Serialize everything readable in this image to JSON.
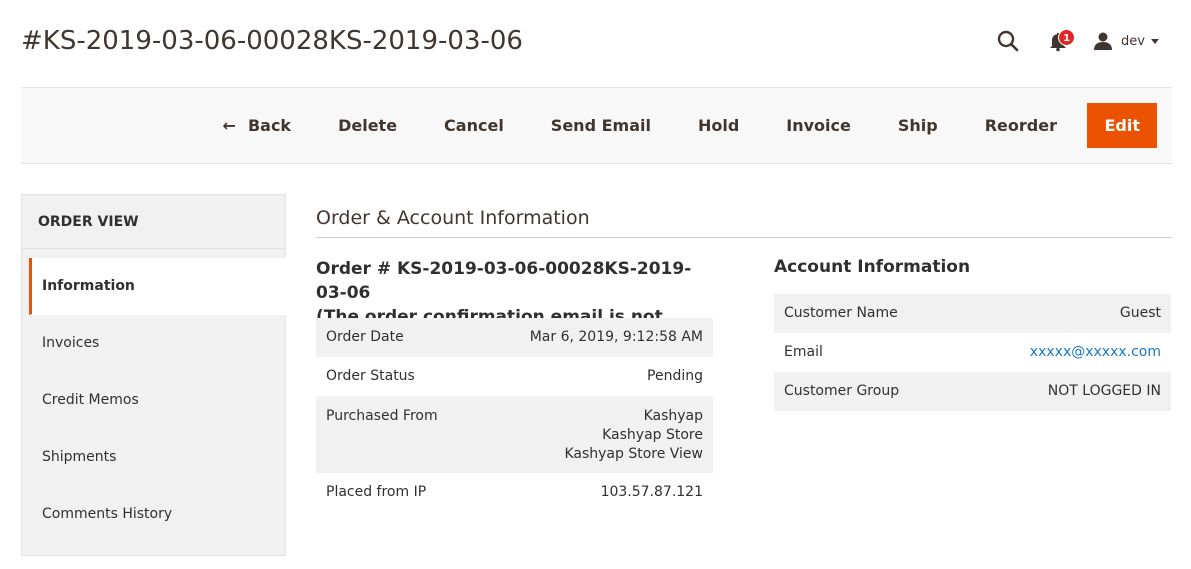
{
  "header": {
    "title": "#KS-2019-03-06-00028KS-2019-03-06",
    "notifications_count": "1",
    "user_name": "dev"
  },
  "toolbar": {
    "back": "Back",
    "delete": "Delete",
    "cancel": "Cancel",
    "send_email": "Send Email",
    "hold": "Hold",
    "invoice": "Invoice",
    "ship": "Ship",
    "reorder": "Reorder",
    "edit": "Edit"
  },
  "sidebar": {
    "title": "ORDER VIEW",
    "items": [
      {
        "label": "Information",
        "active": true
      },
      {
        "label": "Invoices"
      },
      {
        "label": "Credit Memos"
      },
      {
        "label": "Shipments"
      },
      {
        "label": "Comments History"
      }
    ]
  },
  "main": {
    "section_title": "Order & Account Information",
    "order_heading_line1": "Order # KS-2019-03-06-00028KS-2019-03-06",
    "order_heading_line2": "(The order confirmation email is not sent)",
    "order_info": {
      "order_date_label": "Order Date",
      "order_date_value": "Mar 6, 2019, 9:12:58 AM",
      "order_status_label": "Order Status",
      "order_status_value": "Pending",
      "purchased_from_label": "Purchased From",
      "purchased_from_lines": [
        "Kashyap",
        "Kashyap Store",
        "Kashyap Store View"
      ],
      "placed_ip_label": "Placed from IP",
      "placed_ip_value": "103.57.87.121"
    },
    "account_heading": "Account Information",
    "account_info": {
      "customer_name_label": "Customer Name",
      "customer_name_value": "Guest",
      "email_label": "Email",
      "email_value": "xxxxx@xxxxx.com",
      "customer_group_label": "Customer Group",
      "customer_group_value": "NOT LOGGED IN"
    }
  },
  "colors": {
    "accent": "#eb5202",
    "link": "#1979c3",
    "badge": "#e22626"
  }
}
